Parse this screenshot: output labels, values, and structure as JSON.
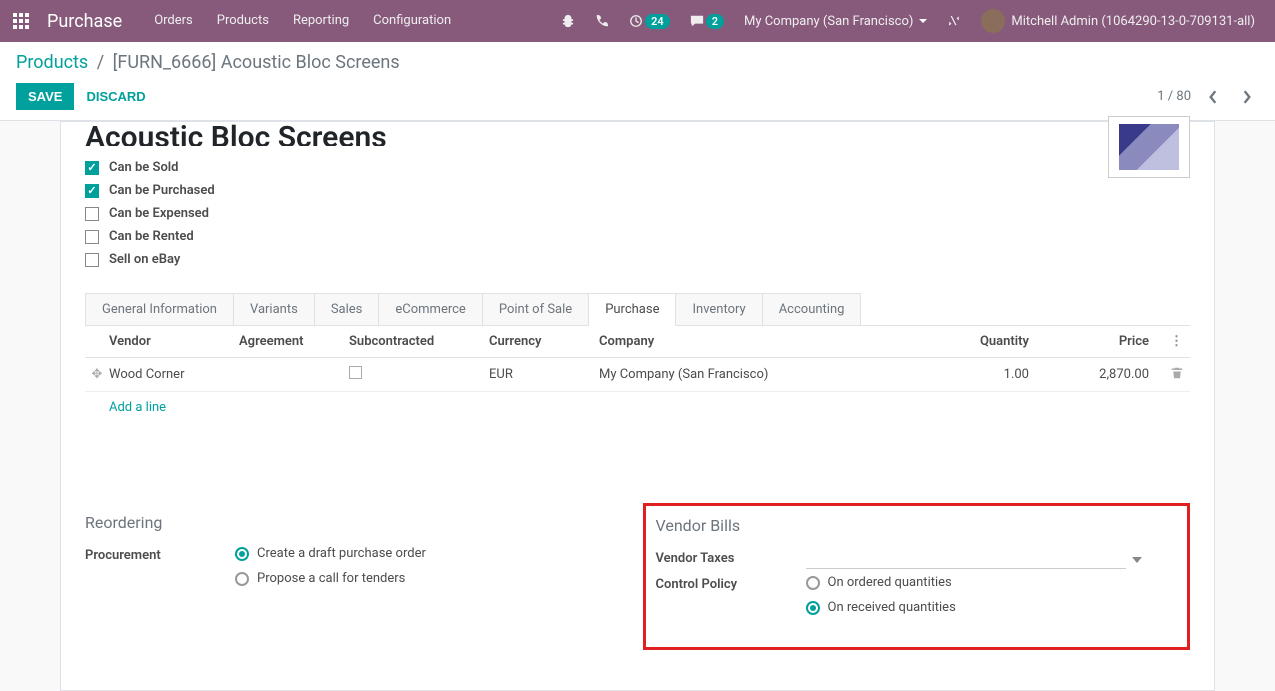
{
  "topbar": {
    "brand": "Purchase",
    "menu": [
      "Orders",
      "Products",
      "Reporting",
      "Configuration"
    ],
    "activity_badge": "24",
    "msg_badge": "2",
    "company": "My Company (San Francisco)",
    "user": "Mitchell Admin (1064290-13-0-709131-all)"
  },
  "breadcrumb": {
    "root": "Products",
    "current": "[FURN_6666] Acoustic Bloc Screens"
  },
  "actions": {
    "save": "SAVE",
    "discard": "DISCARD"
  },
  "pager": {
    "text": "1 / 80"
  },
  "product": {
    "name": "Acoustic Bloc Screens",
    "flags": {
      "can_be_sold": {
        "label": "Can be Sold",
        "checked": true
      },
      "can_be_purchased": {
        "label": "Can be Purchased",
        "checked": true
      },
      "can_be_expensed": {
        "label": "Can be Expensed",
        "checked": false
      },
      "can_be_rented": {
        "label": "Can be Rented",
        "checked": false
      },
      "sell_on_ebay": {
        "label": "Sell on eBay",
        "checked": false
      }
    }
  },
  "tabs": [
    "General Information",
    "Variants",
    "Sales",
    "eCommerce",
    "Point of Sale",
    "Purchase",
    "Inventory",
    "Accounting"
  ],
  "active_tab": "Purchase",
  "vendor_table": {
    "headers": {
      "vendor": "Vendor",
      "agreement": "Agreement",
      "subcontracted": "Subcontracted",
      "currency": "Currency",
      "company": "Company",
      "quantity": "Quantity",
      "price": "Price"
    },
    "row": {
      "vendor": "Wood Corner",
      "agreement": "",
      "currency": "EUR",
      "company": "My Company (San Francisco)",
      "quantity": "1.00",
      "price": "2,870.00"
    },
    "add_line": "Add a line"
  },
  "reordering": {
    "title": "Reordering",
    "procurement_label": "Procurement",
    "opt_draft": "Create a draft purchase order",
    "opt_tender": "Propose a call for tenders"
  },
  "vendor_bills": {
    "title": "Vendor Bills",
    "taxes_label": "Vendor Taxes",
    "policy_label": "Control Policy",
    "opt_ordered": "On ordered quantities",
    "opt_received": "On received quantities"
  }
}
